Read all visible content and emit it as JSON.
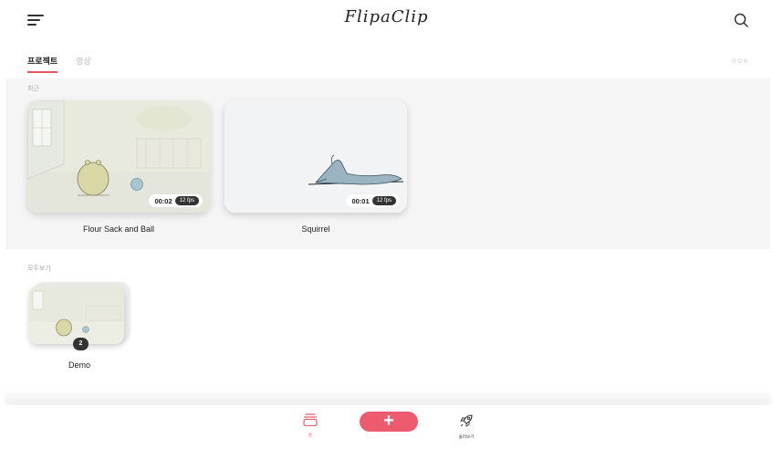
{
  "app": {
    "title": "FlipaClip"
  },
  "tabs": [
    {
      "label": "프로젝트",
      "active": true
    },
    {
      "label": "영상",
      "active": false
    }
  ],
  "sections": {
    "recent": "최근",
    "all": "모두보기"
  },
  "recent_projects": [
    {
      "title": "Flour Sack and Ball",
      "duration": "00:02",
      "fps": "12 fps"
    },
    {
      "title": "Squirrel",
      "duration": "00:01",
      "fps": "12 fps"
    }
  ],
  "folders": [
    {
      "title": "Demo",
      "count": "2"
    }
  ],
  "nav": {
    "home_label": "홈",
    "add_label": "+",
    "explore_label": "둘러보기"
  },
  "colors": {
    "accent": "#ec5b6e",
    "tab_underline": "#e8545f"
  },
  "icons": [
    "menu-icon",
    "search-icon",
    "more-icon",
    "home-stack-icon",
    "plus-icon",
    "rocket-icon"
  ]
}
